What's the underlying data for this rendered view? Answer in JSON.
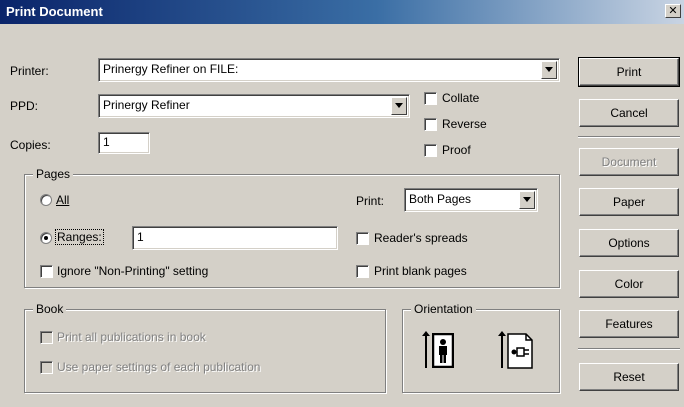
{
  "window": {
    "title": "Print Document",
    "close_glyph": "✕"
  },
  "printer": {
    "label": "Printer:",
    "value": "Prinergy Refiner on FILE:"
  },
  "ppd": {
    "label": "PPD:",
    "value": "Prinergy Refiner"
  },
  "copies": {
    "label": "Copies:",
    "value": "1"
  },
  "options": {
    "collate": {
      "label": "Collate",
      "checked": false
    },
    "reverse": {
      "label": "Reverse",
      "checked": false
    },
    "proof": {
      "label": "Proof",
      "checked": false
    }
  },
  "pages": {
    "legend": "Pages",
    "all_label": "All",
    "ranges_label": "Ranges:",
    "ranges_value": "1",
    "selected": "ranges",
    "print_label": "Print:",
    "print_value": "Both Pages",
    "readers_spreads": {
      "label": "Reader's spreads",
      "checked": false
    },
    "ignore_nonprinting": {
      "label": "Ignore \"Non-Printing\" setting",
      "checked": false
    },
    "print_blank": {
      "label": "Print blank pages",
      "checked": false
    }
  },
  "book": {
    "legend": "Book",
    "print_all": {
      "label": "Print all publications in book",
      "enabled": false
    },
    "use_paper": {
      "label": "Use paper settings of each publication",
      "enabled": false
    }
  },
  "orientation": {
    "legend": "Orientation",
    "icons": [
      "portrait-orientation-icon",
      "landscape-orientation-icon"
    ]
  },
  "buttons": {
    "print": "Print",
    "cancel": "Cancel",
    "document": "Document",
    "paper": "Paper",
    "options": "Options",
    "color": "Color",
    "features": "Features",
    "reset": "Reset"
  }
}
